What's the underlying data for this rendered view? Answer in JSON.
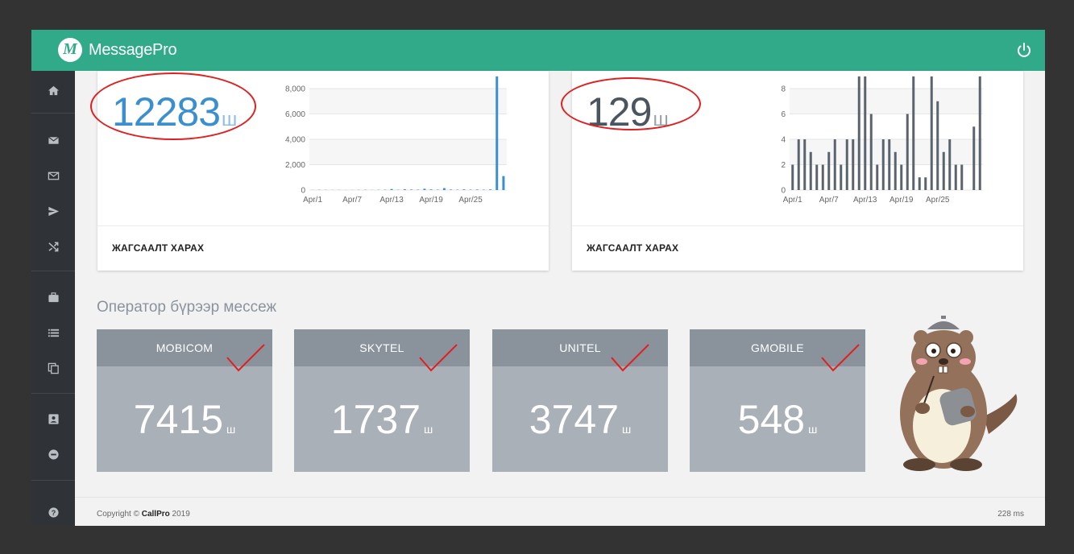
{
  "header": {
    "brand": "MessagePro",
    "logo_letter": "M"
  },
  "sidebar": {
    "icons": [
      "home-icon",
      "mail-icon",
      "mail-outline-icon",
      "send-icon",
      "shuffle-icon",
      "briefcase-icon",
      "list-icon",
      "copy-icon",
      "contact-card-icon",
      "minus-circle-icon",
      "help-icon"
    ]
  },
  "cards": [
    {
      "total": "12283",
      "unit": "ш",
      "color": "#3a8fd0",
      "footer": "ЖАГСААЛТ ХАРАХ"
    },
    {
      "total": "129",
      "unit": "ш",
      "color": "#4a5560",
      "footer": "ЖАГСААЛТ ХАРАХ"
    }
  ],
  "chart_data": [
    {
      "type": "bar",
      "x_ticks": [
        "Apr/1",
        "Apr/7",
        "Apr/13",
        "Apr/19",
        "Apr/25"
      ],
      "y_ticks": [
        "0",
        "2,000",
        "4,000",
        "6,000",
        "8,000"
      ],
      "ylim": [
        0,
        8000
      ],
      "color": "#3a8fd0",
      "values": [
        10,
        20,
        15,
        10,
        12,
        8,
        10,
        15,
        20,
        12,
        18,
        25,
        80,
        20,
        60,
        40,
        30,
        100,
        50,
        30,
        150,
        40,
        30,
        50,
        30,
        40,
        30,
        50,
        9500,
        1100
      ]
    },
    {
      "type": "bar",
      "x_ticks": [
        "Apr/1",
        "Apr/7",
        "Apr/13",
        "Apr/19",
        "Apr/25"
      ],
      "y_ticks": [
        "0",
        "2",
        "4",
        "6",
        "8"
      ],
      "ylim": [
        0,
        8
      ],
      "color": "#5a646e",
      "values": [
        2,
        4,
        4,
        3,
        2,
        2,
        3,
        4,
        2,
        4,
        4,
        9,
        9,
        6,
        2,
        4,
        4,
        3,
        2,
        6,
        9,
        1,
        1,
        9,
        7,
        3,
        4,
        2,
        2,
        0,
        5,
        9
      ]
    }
  ],
  "operators_title": "Оператор бүрээр мессеж",
  "operators": [
    {
      "name": "MOBICOM",
      "value": "7415",
      "unit": "ш"
    },
    {
      "name": "SKYTEL",
      "value": "1737",
      "unit": "ш"
    },
    {
      "name": "UNITEL",
      "value": "3747",
      "unit": "ш"
    },
    {
      "name": "GMOBILE",
      "value": "548",
      "unit": "ш"
    }
  ],
  "footer": {
    "copyright_prefix": "Copyright © ",
    "company": "CallPro",
    "year": " 2019",
    "timing": "228 ms"
  }
}
